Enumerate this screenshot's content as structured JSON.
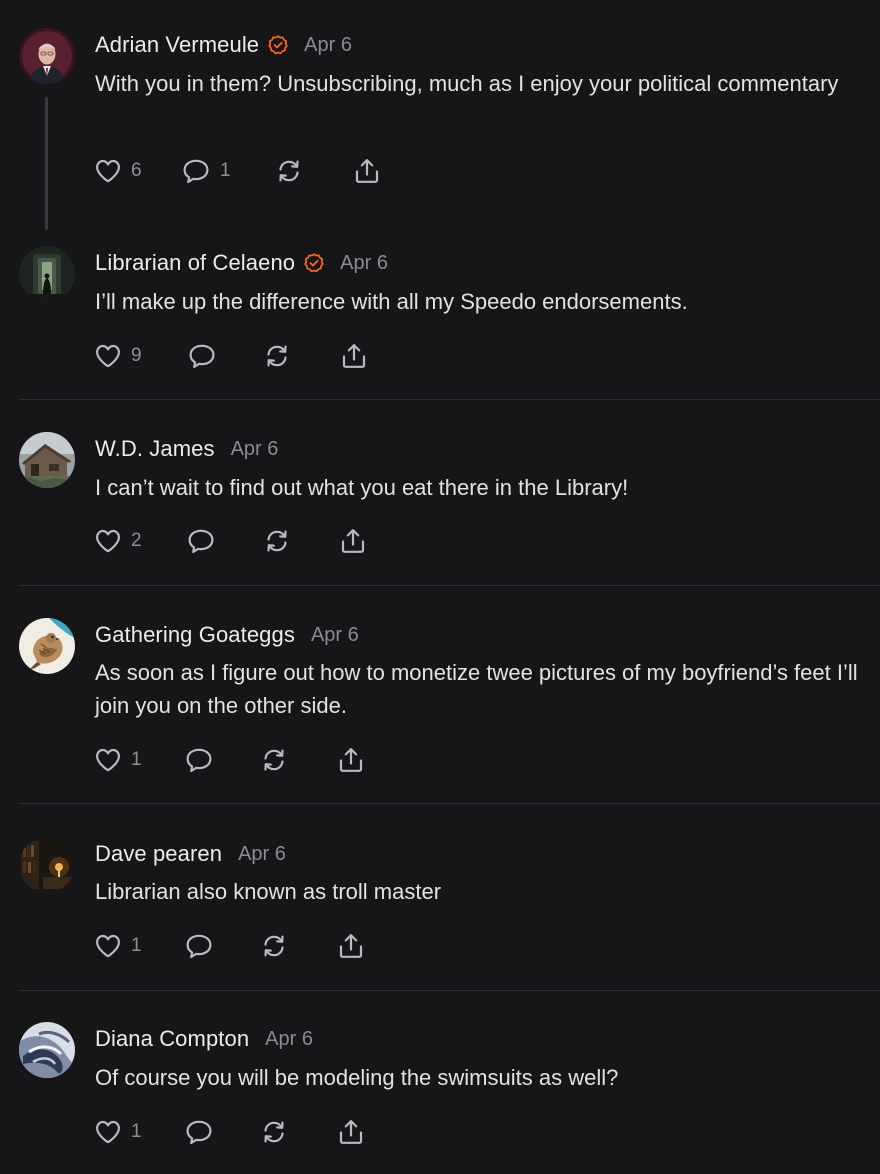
{
  "theme": {
    "background": "#161618",
    "text": "#e7e7e9",
    "muted": "#8b8b90",
    "accent": "#ff6719",
    "divider": "#2c2c30"
  },
  "comments": [
    {
      "author": "Adrian Vermeule",
      "verified": true,
      "date": "Apr 6",
      "text": "With you in them? Unsubscribing, much as I enjoy your political commentary",
      "likes": "6",
      "replies": "1",
      "avatar": "portrait-man-suit"
    },
    {
      "author": "Librarian of Celaeno",
      "verified": true,
      "date": "Apr 6",
      "text": "I’ll make up the difference with all my Speedo endorsements.",
      "likes": "9",
      "replies": "",
      "avatar": "dark-doorway-figure"
    },
    {
      "author": "W.D. James",
      "verified": false,
      "date": "Apr 6",
      "text": "I can’t wait to find out what you eat there in the Library!",
      "likes": "2",
      "replies": "",
      "avatar": "old-cabin"
    },
    {
      "author": "Gathering Goateggs",
      "verified": false,
      "date": "Apr 6",
      "text": "As soon as I figure out how to monetize twee pictures of my boyfriend’s feet I’ll join you on the other side.",
      "likes": "1",
      "replies": "",
      "avatar": "bird-drawing"
    },
    {
      "author": "Dave pearen",
      "verified": false,
      "date": "Apr 6",
      "text": "Librarian also known as troll master",
      "likes": "1",
      "replies": "",
      "avatar": "candlelit-library"
    },
    {
      "author": "Diana Compton",
      "verified": false,
      "date": "Apr 6",
      "text": "Of course you will be modeling the swimsuits as well?",
      "likes": "1",
      "replies": "",
      "avatar": "abstract-swirl"
    }
  ],
  "icons": {
    "like": "heart-icon",
    "reply": "comment-bubble-icon",
    "restack": "restack-icon",
    "share": "share-icon",
    "verified": "verified-badge-icon"
  }
}
